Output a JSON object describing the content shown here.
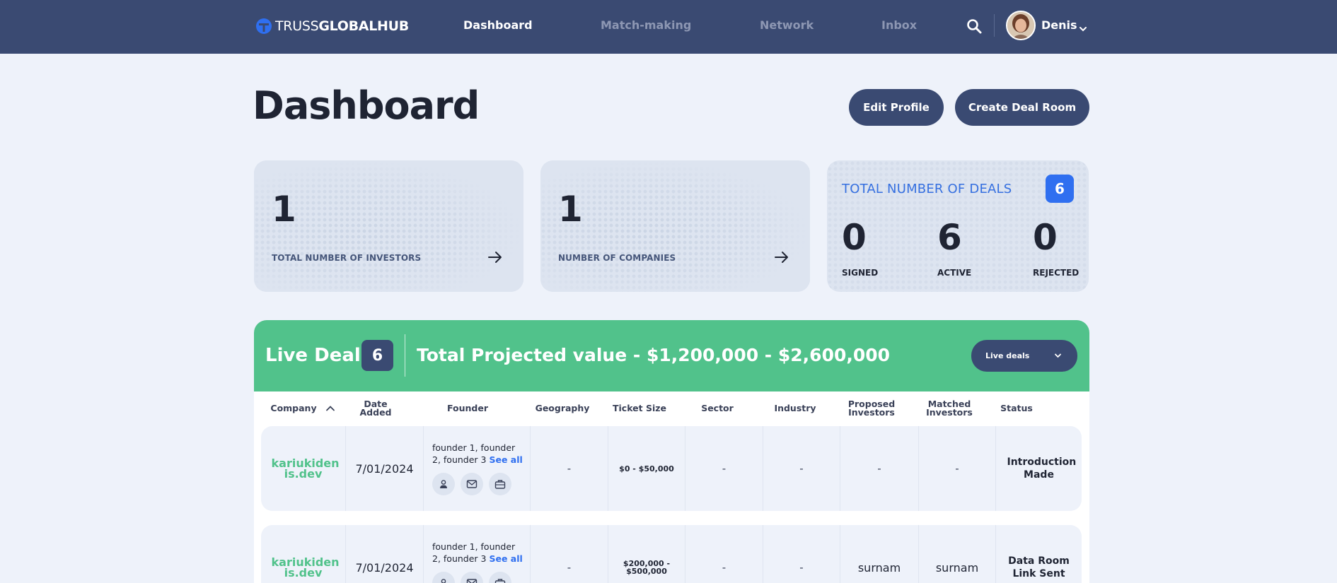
{
  "nav": {
    "logo_light": "TRUSS",
    "logo_bold": "GLOBALHUB",
    "links": [
      "Dashboard",
      "Match-making",
      "Network",
      "Inbox"
    ],
    "active": "Dashboard",
    "user_name": "Denis"
  },
  "header": {
    "title": "Dashboard",
    "edit_profile": "Edit Profile",
    "create_deal_room": "Create Deal Room"
  },
  "cards": {
    "investors": {
      "value": "1",
      "label": "TOTAL NUMBER OF INVESTORS"
    },
    "companies": {
      "value": "1",
      "label": "NUMBER OF COMPANIES"
    },
    "deals": {
      "title": "TOTAL NUMBER OF DEALS",
      "total": "6",
      "signed": {
        "value": "0",
        "label": "SIGNED"
      },
      "active": {
        "value": "6",
        "label": "ACTIVE"
      },
      "rejected": {
        "value": "0",
        "label": "REJECTED"
      }
    }
  },
  "live_deals": {
    "title": "Live Deals",
    "count": "6",
    "total_projected": "Total Projected value - $1,200,000 - $2,600,000",
    "filter_value": "Live deals"
  },
  "table": {
    "columns": [
      "Company",
      "Date Added",
      "Founder",
      "Geography",
      "Ticket Size",
      "Sector",
      "Industry",
      "Proposed Investors",
      "Matched Investors",
      "Status"
    ],
    "rows": [
      {
        "company": "kariukiden is.dev",
        "date": "7/01/2024",
        "founders": "founder 1, founder 2, founder 3",
        "see_all": "See all",
        "geography": "-",
        "ticket": "$0 - $50,000",
        "sector": "-",
        "industry": "-",
        "proposed": "-",
        "matched": "-",
        "status": "Introduction Made"
      },
      {
        "company": "kariukiden is.dev",
        "date": "7/01/2024",
        "founders": "founder 1, founder 2, founder 3",
        "see_all": "See all",
        "geography": "-",
        "ticket": "$200,000 - $500,000",
        "sector": "-",
        "industry": "-",
        "proposed": "surnam",
        "matched": "surnam",
        "status": "Data Room Link Sent"
      }
    ]
  },
  "colors": {
    "navbar": "#3a4a72",
    "accent_green": "#51c28b",
    "accent_blue": "#2f6ff0",
    "page_bg": "#eef2fa"
  }
}
